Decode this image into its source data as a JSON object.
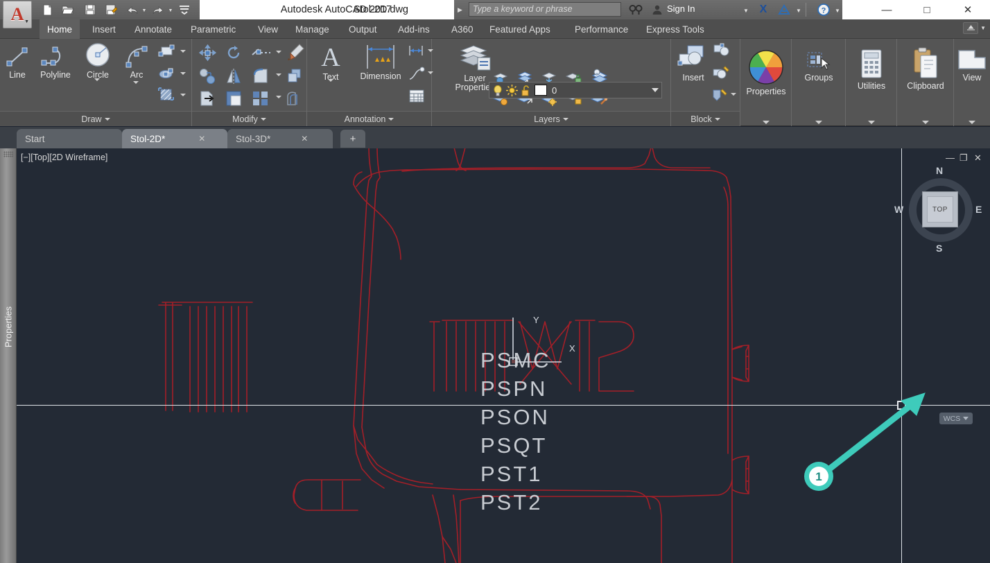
{
  "titlebar": {
    "app_title": "Autodesk AutoCAD 2017",
    "document_name": "Stol-2D.dwg",
    "search_placeholder": "Type a keyword or phrase",
    "sign_in_label": "Sign In",
    "quick_access": [
      {
        "name": "new-icon",
        "glyph": "⬜"
      },
      {
        "name": "open-icon",
        "glyph": "📂"
      },
      {
        "name": "save-icon",
        "glyph": "💾"
      },
      {
        "name": "save-as-icon",
        "glyph": "📝"
      },
      {
        "name": "undo-icon",
        "glyph": "↩"
      },
      {
        "name": "redo-icon",
        "glyph": "↪"
      },
      {
        "name": "customize-icon",
        "glyph": "≡"
      }
    ],
    "window_controls": {
      "minimize": "—",
      "maximize": "□",
      "close": "✕"
    },
    "help_label": "?",
    "exchange_label": "X",
    "a360_label": "A"
  },
  "ribbon_tabs": [
    {
      "label": "Home",
      "active": true
    },
    {
      "label": "Insert",
      "active": false
    },
    {
      "label": "Annotate",
      "active": false
    },
    {
      "label": "Parametric",
      "active": false
    },
    {
      "label": "View",
      "active": false
    },
    {
      "label": "Manage",
      "active": false
    },
    {
      "label": "Output",
      "active": false
    },
    {
      "label": "Add-ins",
      "active": false
    },
    {
      "label": "A360",
      "active": false
    },
    {
      "label": "Featured Apps",
      "active": false
    },
    {
      "label": "Performance",
      "active": false
    },
    {
      "label": "Express Tools",
      "active": false
    }
  ],
  "panels": {
    "draw": {
      "title": "Draw",
      "buttons": [
        {
          "label": "Line",
          "icon": "line-icon"
        },
        {
          "label": "Polyline",
          "icon": "polyline-icon"
        },
        {
          "label": "Circle",
          "icon": "circle-icon"
        },
        {
          "label": "Arc",
          "icon": "arc-icon"
        }
      ],
      "small_icons": [
        "rectangle-icon",
        "ellipse-icon",
        "hatch-icon"
      ]
    },
    "modify": {
      "title": "Modify",
      "small_icons": [
        "move-icon",
        "rotate-icon",
        "trim-icon",
        "erase-icon",
        "copy-icon",
        "mirror-icon",
        "fillet-icon",
        "array-icon",
        "stretch-icon",
        "scale-icon",
        "explode-icon",
        "offset-icon"
      ]
    },
    "annotation": {
      "title": "Annotation",
      "buttons": [
        {
          "label": "Text",
          "icon": "text-icon"
        },
        {
          "label": "Dimension",
          "icon": "dimension-icon"
        }
      ],
      "small_icons": [
        "linear-dim-icon",
        "leader-icon",
        "table-icon"
      ]
    },
    "layers": {
      "title": "Layers",
      "button_label": "Layer\nProperties",
      "button_label_line1": "Layer",
      "button_label_line2": "Properties",
      "layer_combo": {
        "layer_name": "0",
        "color_swatch": "#ffffff",
        "icons": [
          "lightbulb-icon",
          "sun-icon",
          "unlock-icon"
        ]
      },
      "small_icons": [
        "layer-isolate-icon",
        "layer-off-icon",
        "layer-freeze-icon",
        "layer-lock-icon",
        "layer-make-current-icon",
        "layer-unisolate-icon",
        "layer-on-icon",
        "layer-thaw-icon",
        "layer-unlock-icon",
        "layer-match-icon"
      ]
    },
    "block": {
      "title": "Block",
      "buttons": [
        {
          "label": "Insert",
          "icon": "insert-block-icon"
        }
      ],
      "small_icons": [
        "create-block-icon",
        "edit-attribute-icon",
        "define-attribute-icon"
      ]
    },
    "properties": {
      "title": "Properties",
      "label": "Properties",
      "icon": "color-wheel-icon"
    },
    "groups": {
      "title": "Groups",
      "label": "Groups",
      "icon": "group-icon"
    },
    "utilities": {
      "title": "Utilities",
      "label": "Utilities",
      "icon": "calculator-icon"
    },
    "clipboard": {
      "title": "Clipboard",
      "label": "Clipboard",
      "icon": "clipboard-icon"
    },
    "view": {
      "title": "View",
      "label": "View",
      "icon": "viewport-icon"
    }
  },
  "document_tabs": [
    {
      "label": "Start",
      "active": false,
      "closable": false
    },
    {
      "label": "Stol-2D*",
      "active": true,
      "closable": true
    },
    {
      "label": "Stol-3D*",
      "active": false,
      "closable": true
    }
  ],
  "new_tab_label": "+",
  "canvas": {
    "properties_palette_label": "Properties",
    "viewport_label": "[−][Top][2D Wireframe]",
    "viewport_controls": {
      "minimize": "—",
      "restore": "❐",
      "close": "✕"
    },
    "crosshair_axis_y": "Y",
    "crosshair_axis_x": "X",
    "drawing_text": [
      "PSMC",
      "PSPN",
      "PSON",
      "PSQT",
      "PST1",
      "PST2"
    ],
    "geometry_color": "#a41f28",
    "background_color": "#232a35",
    "crosshair_color": "#dfe3e8"
  },
  "viewcube": {
    "face_label": "TOP",
    "north": "N",
    "south": "S",
    "east": "E",
    "west": "W",
    "wcs_label": "WCS"
  },
  "annotation": {
    "marker_number": "1",
    "color": "#3ecbbb",
    "number_color": "#1f8d83"
  }
}
